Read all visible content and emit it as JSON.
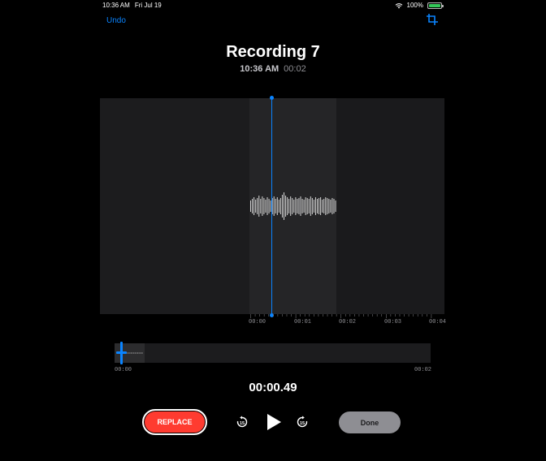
{
  "status_bar": {
    "time": "10:36 AM",
    "date": "Fri Jul 19",
    "battery": "100%"
  },
  "nav": {
    "undo_label": "Undo",
    "crop_icon": "crop-icon"
  },
  "recording": {
    "title": "Recording 7",
    "time": "10:36 AM",
    "duration": "00:02"
  },
  "waveform": {
    "tick_labels": [
      "00:00",
      "00:01",
      "00:02",
      "00:03",
      "00:04"
    ]
  },
  "overview": {
    "start_label": "00:00",
    "end_label": "00:02"
  },
  "playback": {
    "current_time": "00:00.49"
  },
  "controls": {
    "replace_label": "REPLACE",
    "skip_back_icon": "skip-back-15-icon",
    "play_icon": "play-icon",
    "skip_forward_icon": "skip-forward-15-icon",
    "done_label": "Done"
  },
  "colors": {
    "accent": "#0a84ff",
    "record": "#ff3b30",
    "battery": "#34c759"
  }
}
